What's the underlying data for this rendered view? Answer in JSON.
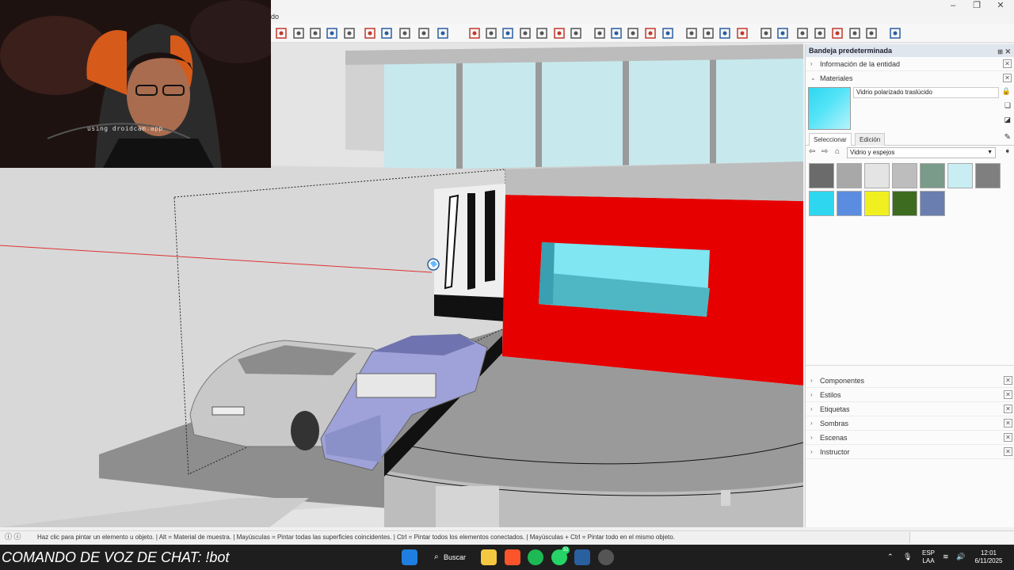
{
  "app": {
    "title_fragment": "do"
  },
  "colors": {
    "accent": "#1f6fd0",
    "red_wall": "#e60000",
    "glass": "#7fe6f2",
    "tray_header": "#dfe6ee"
  },
  "toolbar": {
    "icons": [
      "select-icon",
      "move-icon",
      "rotate-icon",
      "zoom-icon",
      "zoom-extents-icon",
      "orbit-icon",
      "styles-icon",
      "layers-icon",
      "camera-icon",
      "iso-view-icon",
      "top-view-icon",
      "front-view-icon",
      "right-view-icon",
      "back-view-icon",
      "left-view-icon",
      "component-icon",
      "material-icon",
      "tag-icon",
      "section-plane-icon",
      "section-cut-icon",
      "x-ray-icon",
      "backedges-icon",
      "wireframe-icon",
      "hidden-line-icon",
      "shaded-icon",
      "textured-icon",
      "monochrome-icon",
      "sandbox-icon",
      "warehouse-icon",
      "extension-icon",
      "dynamic-component-icon",
      "solid-tools-icon",
      "paint-bucket-icon",
      "extension-warehouse-icon"
    ]
  },
  "webcam": {
    "overlay_text": "using droidcam.app"
  },
  "tray": {
    "title": "Bandeja predeterminada",
    "entity_info_label": "Información de la entidad",
    "materials_label": "Materiales",
    "material_name": "Vidrio polarizado traslúcido",
    "tab_select": "Seleccionar",
    "tab_edit": "Edición",
    "library": "Vidrio y espejos",
    "swatches": [
      {
        "name": "swatch-grid-stone",
        "color": "#6b6b6b"
      },
      {
        "name": "swatch-gray-gradient",
        "color": "#a8a8a8"
      },
      {
        "name": "swatch-white-gradient",
        "color": "#e4e4e4"
      },
      {
        "name": "swatch-speckle",
        "color": "#bdbdbd"
      },
      {
        "name": "swatch-green-texture",
        "color": "#7a9a8a"
      },
      {
        "name": "swatch-light-cyan",
        "color": "#c8eef4"
      },
      {
        "name": "swatch-dark-gray",
        "color": "#7f7f7f"
      },
      {
        "name": "swatch-cyan",
        "color": "#2fd6f0"
      },
      {
        "name": "swatch-blue",
        "color": "#5a8de0"
      },
      {
        "name": "swatch-yellow",
        "color": "#f0f020"
      },
      {
        "name": "swatch-dark-green",
        "color": "#3d6b1f"
      },
      {
        "name": "swatch-blue-texture",
        "color": "#6a7fb0"
      }
    ],
    "sections": [
      "Componentes",
      "Estilos",
      "Etiquetas",
      "Sombras",
      "Escenas",
      "Instructor"
    ]
  },
  "status": {
    "text": "Haz clic para pintar un elemento u objeto. | Alt = Material de muestra. | Mayúsculas = Pintar todas las superficies coincidentes. | Ctrl = Pintar todos los elementos conectados. | Mayúsculas + Ctrl = Pintar todo en el mismo objeto."
  },
  "overlay": {
    "command_text": "COMANDO DE VOZ DE CHAT: !bot"
  },
  "taskbar": {
    "search_label": "Buscar",
    "whatsapp_badge": "32",
    "lang_top": "ESP",
    "lang_bottom": "LAA",
    "time": "12:01",
    "date": "6/11/2025"
  }
}
